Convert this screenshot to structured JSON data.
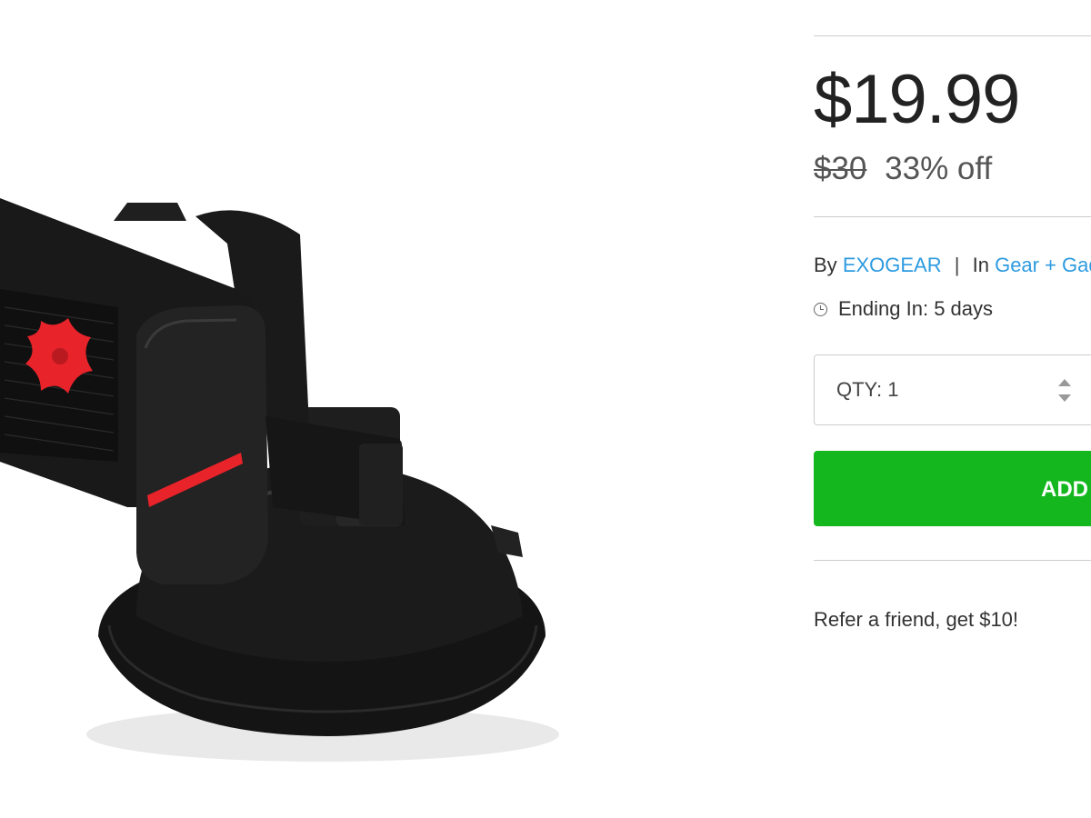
{
  "product": {
    "image_alt": "Exogear car phone mount with suction cup base"
  },
  "pricing": {
    "price": "$19.99",
    "original_price": "$30",
    "discount": "33% off"
  },
  "meta": {
    "by_label": "By",
    "brand": "EXOGEAR",
    "separator": "|",
    "in_label": "In",
    "category": "Gear + Gadgets"
  },
  "ending": {
    "text": "Ending In: 5 days"
  },
  "quantity": {
    "label": "QTY: 1"
  },
  "add_button": {
    "label": "ADD TO CART"
  },
  "refer": {
    "text": "Refer a friend, get $10!"
  },
  "colors": {
    "accent_green": "#14b81e",
    "link_blue": "#2d9be0",
    "mount_red": "#e8232a"
  }
}
